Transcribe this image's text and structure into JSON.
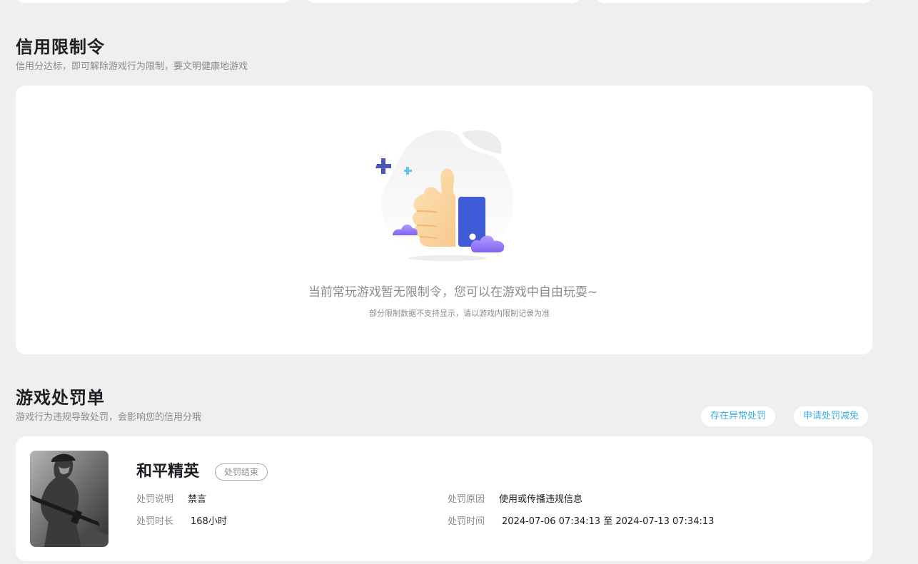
{
  "restriction": {
    "title": "信用限制令",
    "subtitle": "信用分达标，即可解除游戏行为限制，要文明健康地游戏",
    "empty_title": "当前常玩游戏暂无限制令，您可以在游戏中自由玩耍~",
    "empty_note": "部分限制数据不支持显示，请以游戏内限制记录为准"
  },
  "penalty": {
    "title": "游戏处罚单",
    "subtitle": "游戏行为违规导致处罚，会影响您的信用分哦",
    "abnormal_button": "存在异常处罚",
    "reduce_button": "申请处罚减免",
    "item": {
      "game": "和平精英",
      "status": "处罚结束",
      "desc_label": "处罚说明",
      "desc_value": "禁言",
      "reason_label": "处罚原因",
      "reason_value": "使用或传播违规信息",
      "duration_label": "处罚时长",
      "duration_value": "168小时",
      "time_label": "处罚时间",
      "time_value": "2024-07-06 07:34:13 至 2024-07-13 07:34:13"
    }
  },
  "colors": {
    "accent": "#3fb0e6",
    "background": "#efefef",
    "card": "#ffffff"
  },
  "icons": {
    "illustration": "thumbs-up-illustration",
    "thumbnail": "game-cover-image"
  }
}
